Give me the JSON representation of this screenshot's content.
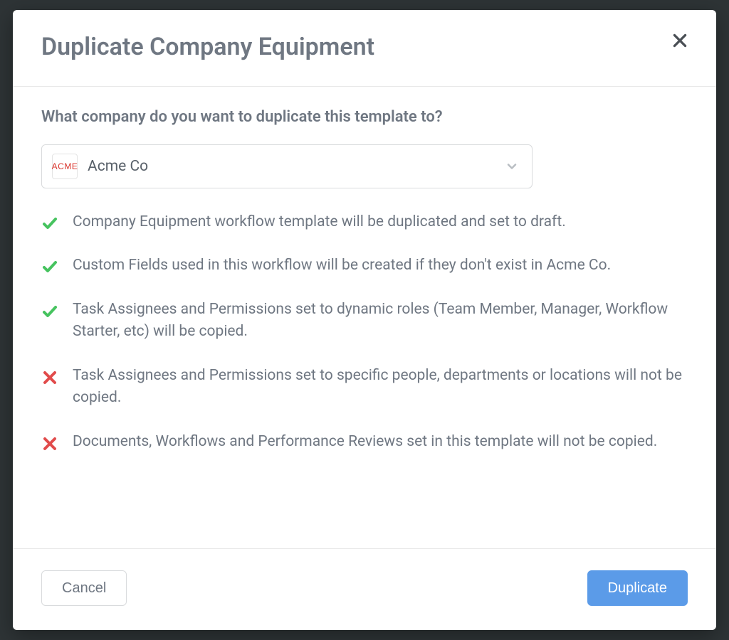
{
  "modal": {
    "title": "Duplicate Company Equipment",
    "prompt": "What company do you want to duplicate this template to?",
    "company": {
      "logo_text": "ACME",
      "name": "Acme Co"
    },
    "notes": [
      {
        "type": "check",
        "text": "Company Equipment workflow template will be duplicated and set to draft."
      },
      {
        "type": "check",
        "text": "Custom Fields used in this workflow will be created if they don't exist in Acme Co."
      },
      {
        "type": "check",
        "text": "Task Assignees and Permissions set to dynamic roles (Team Member, Manager, Workflow Starter, etc) will be copied."
      },
      {
        "type": "cross",
        "text": "Task Assignees and Permissions set to specific people, departments or locations will not be copied."
      },
      {
        "type": "cross",
        "text": "Documents, Workflows and Performance Reviews set in this template will not be copied."
      }
    ],
    "buttons": {
      "cancel": "Cancel",
      "duplicate": "Duplicate"
    }
  },
  "colors": {
    "text_muted": "#6f7782",
    "check_green": "#46c35f",
    "cross_red": "#e14b4b",
    "primary_blue": "#5b9be8"
  }
}
